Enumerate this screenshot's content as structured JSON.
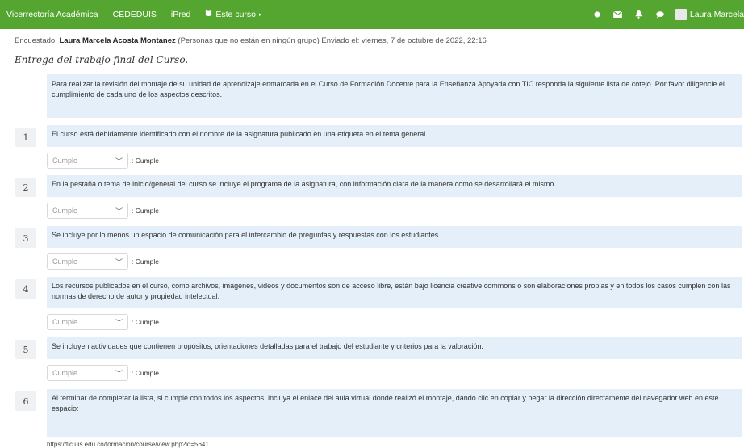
{
  "nav": {
    "items": [
      "Vicerrectoría Académica",
      "CEDEDUIS",
      "iPred"
    ],
    "course_menu": "Este curso",
    "course_menu_arrow": "▸",
    "course_icon": "book-icon",
    "user_name": "Laura Marcela"
  },
  "meta": {
    "prefix": "Encuestado:",
    "respondent": "Laura Marcela Acosta Montanez",
    "suffix": "(Personas que no están en ningún grupo) Enviado el: viernes, 7 de octubre de 2022, 22:16"
  },
  "page_title": "Entrega del trabajo final del Curso.",
  "intro": "Para realizar la revisión del montaje de su unidad de aprendizaje enmarcada en el Curso de Formación Docente para la Enseñanza Apoyada con TIC responda la siguiente lista de cotejo. Por favor diligencie el cumplimiento de cada uno de los aspectos descritos.",
  "questions": [
    {
      "number": "1",
      "text": "El curso está debidamente identificado con el nombre de la asignatura publicado en una etiqueta en el tema general.",
      "select_placeholder": "Cumple",
      "answer": ": Cumple"
    },
    {
      "number": "2",
      "text": "En la pestaña o tema de inicio/general del curso se incluye el programa de la asignatura, con información clara de la manera como se desarrollará el mismo.",
      "select_placeholder": "Cumple",
      "answer": ": Cumple"
    },
    {
      "number": "3",
      "text": "Se incluye por lo menos un espacio de comunicación para el intercambio de preguntas y respuestas con los estudiantes.",
      "select_placeholder": "Cumple",
      "answer": ": Cumple"
    },
    {
      "number": "4",
      "text": "Los recursos publicados en el curso, como archivos, imágenes, videos y documentos son de acceso libre, están bajo licencia creative commons o son elaboraciones propias y en todos los casos cumplen con las normas de derecho de autor y propiedad intelectual.",
      "select_placeholder": "Cumple",
      "answer": ": Cumple"
    },
    {
      "number": "5",
      "text": "Se incluyen actividades que contienen propósitos, orientaciones detalladas para el trabajo del estudiante y criterios para la valoración.",
      "select_placeholder": "Cumple",
      "answer": ": Cumple"
    },
    {
      "number": "6",
      "text": "Al terminar de completar la lista, si cumple con todos los aspectos, incluya el enlace del aula virtual donde realizó el montaje, dando clic en copiar y pegar la dirección directamente del navegador web en este espacio:"
    }
  ],
  "answer_url": "https://tic.uis.edu.co/formacion/course/view.php?id=5641",
  "icons": {
    "globe": "globe-icon",
    "mail": "envelope-icon",
    "bell": "bell-icon",
    "chat": "chat-bubble-icon",
    "dropdown": "chevron-down-icon"
  },
  "colors": {
    "navbar": "#55a630",
    "question_bg": "#e4eff9",
    "number_bg": "#f0f1f2"
  }
}
